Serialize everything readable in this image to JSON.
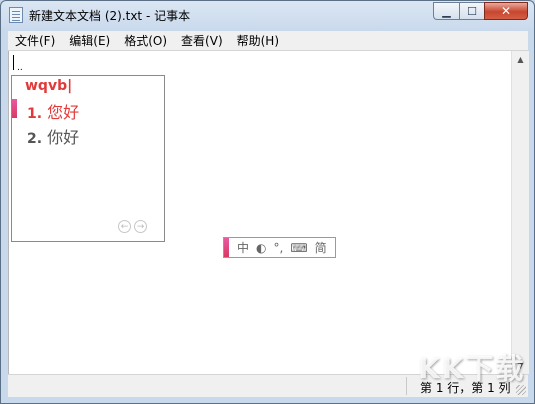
{
  "window": {
    "title": "新建文本文档 (2).txt - 记事本",
    "icon": "notepad-icon",
    "controls": {
      "minimize": "▁",
      "maximize": "☐",
      "close": "✕"
    }
  },
  "menu": {
    "items": [
      {
        "label": "文件(F)"
      },
      {
        "label": "编辑(E)"
      },
      {
        "label": "格式(O)"
      },
      {
        "label": "查看(V)"
      },
      {
        "label": "帮助(H)"
      }
    ]
  },
  "editor": {
    "content": ""
  },
  "ime": {
    "composition": "wqvb|",
    "candidates": [
      {
        "num": "1.",
        "text": "您好",
        "selected": true
      },
      {
        "num": "2.",
        "text": "你好",
        "selected": false
      }
    ],
    "pager": {
      "prev": "←",
      "next": "→"
    },
    "toolbar": {
      "mode": "中",
      "punct": "°,",
      "keyboard": "⌨",
      "charset": "简"
    },
    "accent_color": "#e23a3a"
  },
  "status": {
    "position": "第 1 行，第 1 列"
  },
  "watermark": "KK下载"
}
